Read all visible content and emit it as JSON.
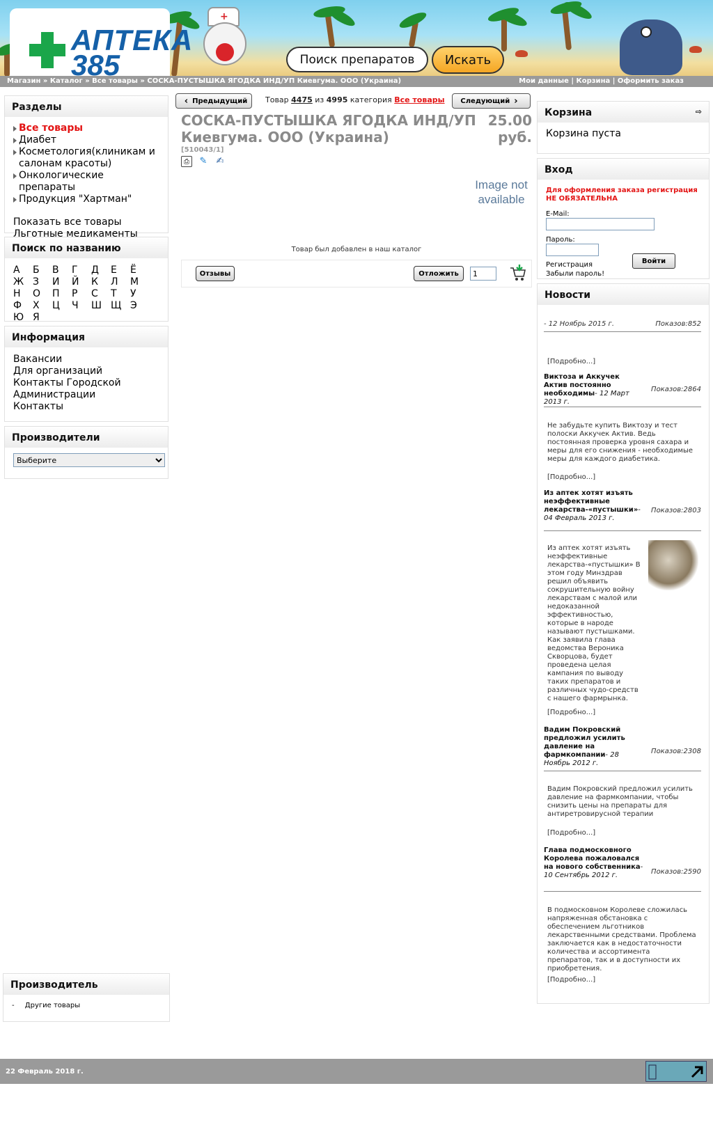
{
  "header": {
    "logo_line1": "АПТЕКА",
    "logo_line2": "385",
    "search_placeholder": "Поиск препаратов",
    "search_button": "Искать"
  },
  "breadcrumb": {
    "items": [
      "Магазин",
      "Каталог",
      "Все товары",
      "СОСКА-ПУСТЫШКА ЯГОДКА ИНД/УП Киевгума. ООО (Украина)"
    ],
    "separator": "»"
  },
  "top_links": [
    "Мои данные",
    "Корзина",
    "Оформить заказ"
  ],
  "sections": {
    "title": "Разделы",
    "items": [
      {
        "label": "Все товары",
        "active": true
      },
      {
        "label": "Диабет",
        "active": false
      },
      {
        "label": "Косметология(клиникам и салонам красоты)",
        "active": false
      },
      {
        "label": "Онкологические препараты",
        "active": false
      },
      {
        "label": "Продукция \"Хартман\"",
        "active": false
      }
    ],
    "extra": [
      "Показать все товары",
      "Льготные медикаменты"
    ]
  },
  "search_by_name": {
    "title": "Поиск по названию",
    "letters": [
      "А",
      "Б",
      "В",
      "Г",
      "Д",
      "Е",
      "Ё",
      "Ж",
      "З",
      "И",
      "Й",
      "К",
      "Л",
      "М",
      "Н",
      "О",
      "П",
      "Р",
      "С",
      "Т",
      "У",
      "Ф",
      "Х",
      "Ц",
      "Ч",
      "Ш",
      "Щ",
      "Э",
      "Ю",
      "Я"
    ]
  },
  "info": {
    "title": "Информация",
    "items": [
      "Вакансии",
      "Для организаций",
      "Контакты Городской Администрации",
      "Контакты"
    ]
  },
  "manufacturers": {
    "title": "Производители",
    "selected": "Выберите"
  },
  "manufacturer_box": {
    "title": "Производитель",
    "item": "Другие товары",
    "bullet": "-"
  },
  "product_nav": {
    "prev": "Предыдущий",
    "next": "Следующий",
    "text_prefix": "Товар",
    "index": "4475",
    "of": "из",
    "total": "4995",
    "category_label": "категория",
    "category": "Все товары"
  },
  "product": {
    "title": "СОСКА-ПУСТЫШКА ЯГОДКА ИНД/УП Киевгума. ООО (Украина)",
    "price": "25.00 руб.",
    "sku": "[510043/1]",
    "no_image": "Image not available",
    "added_text": "Товар был добавлен в наш каталог",
    "reviews_button": "Отзывы",
    "save_button": "Отложить",
    "quantity": "1"
  },
  "cart": {
    "title": "Корзина",
    "empty": "Корзина пуста"
  },
  "login": {
    "title": "Вход",
    "notice_line1": "Для оформления заказа регистрация",
    "notice_line2": "НЕ ОБЯЗАТЕЛЬНА",
    "email_label": "E-Mail:",
    "password_label": "Пароль:",
    "login_button": "Войти",
    "register": "Регистрация",
    "forgot": "Забыли пароль!"
  },
  "news": {
    "title": "Новости",
    "more": "[Подробно...]",
    "items": [
      {
        "title": "",
        "date": "- 12 Ноябрь 2015 г.",
        "views": "Показов:852",
        "text": ""
      },
      {
        "title": "Виктоза и Аккучек Актив постоянно необходимы",
        "date": "- 12 Март 2013 г.",
        "views": "Показов:2864",
        "text": "Не забудьте купить Виктозу и тест полоски Аккучек Актив. Ведь постоянная проверка уровня сахара и меры для его снижения - необходимые меры для каждого диабетика."
      },
      {
        "title": "Из аптек хотят изъять неэффективные лекарства-«пустышки»",
        "date": "- 04 Февраль 2013 г.",
        "views": "Показов:2803",
        "text": "Из аптек хотят изъять неэффективные лекарства-«пустышки» В этом году Минздрав решил объявить сокрушительную войну лекарствам с малой или недоказанной эффективностью, которые в народе называют пустышками. Как заявила глава ведомства Вероника Скворцова, будет проведена целая кампания по выводу таких препаратов и различных чудо-средств с нашего фармрынка."
      },
      {
        "title": "Вадим Покровский предложил усилить давление на фармкомпании",
        "date": "- 28 Ноябрь 2012 г.",
        "views": "Показов:2308",
        "text": "Вадим Покровский предложил усилить давление на фармкомпании, чтобы снизить цены на препараты для антиретровирусной терапии"
      },
      {
        "title": "Глава подмосковного Королева пожаловался на нового собственника",
        "date": "- 10 Сентябрь 2012 г.",
        "views": "Показов:2590",
        "text": "В подмосковном Королеве сложилась напряженная обстановка с обеспечением льготников лекарственными средствами. Проблема заключается как в недостаточности количества и ассортимента препаратов, так и в доступности их приобретения."
      }
    ]
  },
  "footer": {
    "date": "22 Февраль 2018 г."
  }
}
